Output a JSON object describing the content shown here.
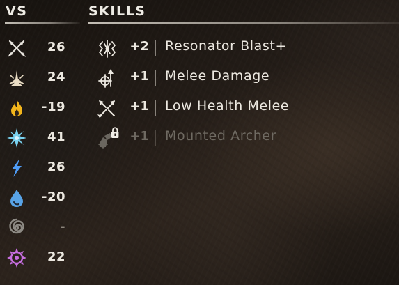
{
  "headers": {
    "vs": "VS",
    "skills": "SKILLS"
  },
  "vs_stats": [
    {
      "icon": "melee-crossed-spears-icon",
      "value": "26",
      "color": "#e9e6df"
    },
    {
      "icon": "impact-burst-icon",
      "value": "24",
      "color": "#e9dcc4"
    },
    {
      "icon": "fire-icon",
      "value": "-19",
      "color": "#f2b51c"
    },
    {
      "icon": "frost-snowflake-icon",
      "value": "41",
      "color": "#79d2f0"
    },
    {
      "icon": "shock-lightning-icon",
      "value": "26",
      "color": "#4f9cf6"
    },
    {
      "icon": "water-drop-icon",
      "value": "-20",
      "color": "#58a3e6"
    },
    {
      "icon": "acid-spiral-icon",
      "value": "-",
      "color": "#8d8a84"
    },
    {
      "icon": "purgewater-sun-icon",
      "value": "22",
      "color": "#c76fe0"
    }
  ],
  "skills": [
    {
      "icon": "resonator-blast-icon",
      "bonus": "+2",
      "name": "Resonator Blast+",
      "locked": false
    },
    {
      "icon": "melee-damage-icon",
      "bonus": "+1",
      "name": "Melee Damage",
      "locked": false
    },
    {
      "icon": "low-health-melee-icon",
      "bonus": "+1",
      "name": "Low Health Melee",
      "locked": false
    },
    {
      "icon": "mounted-archer-icon",
      "bonus": "+1",
      "name": "Mounted Archer",
      "locked": true,
      "lock_icon": "padlock-icon"
    }
  ]
}
